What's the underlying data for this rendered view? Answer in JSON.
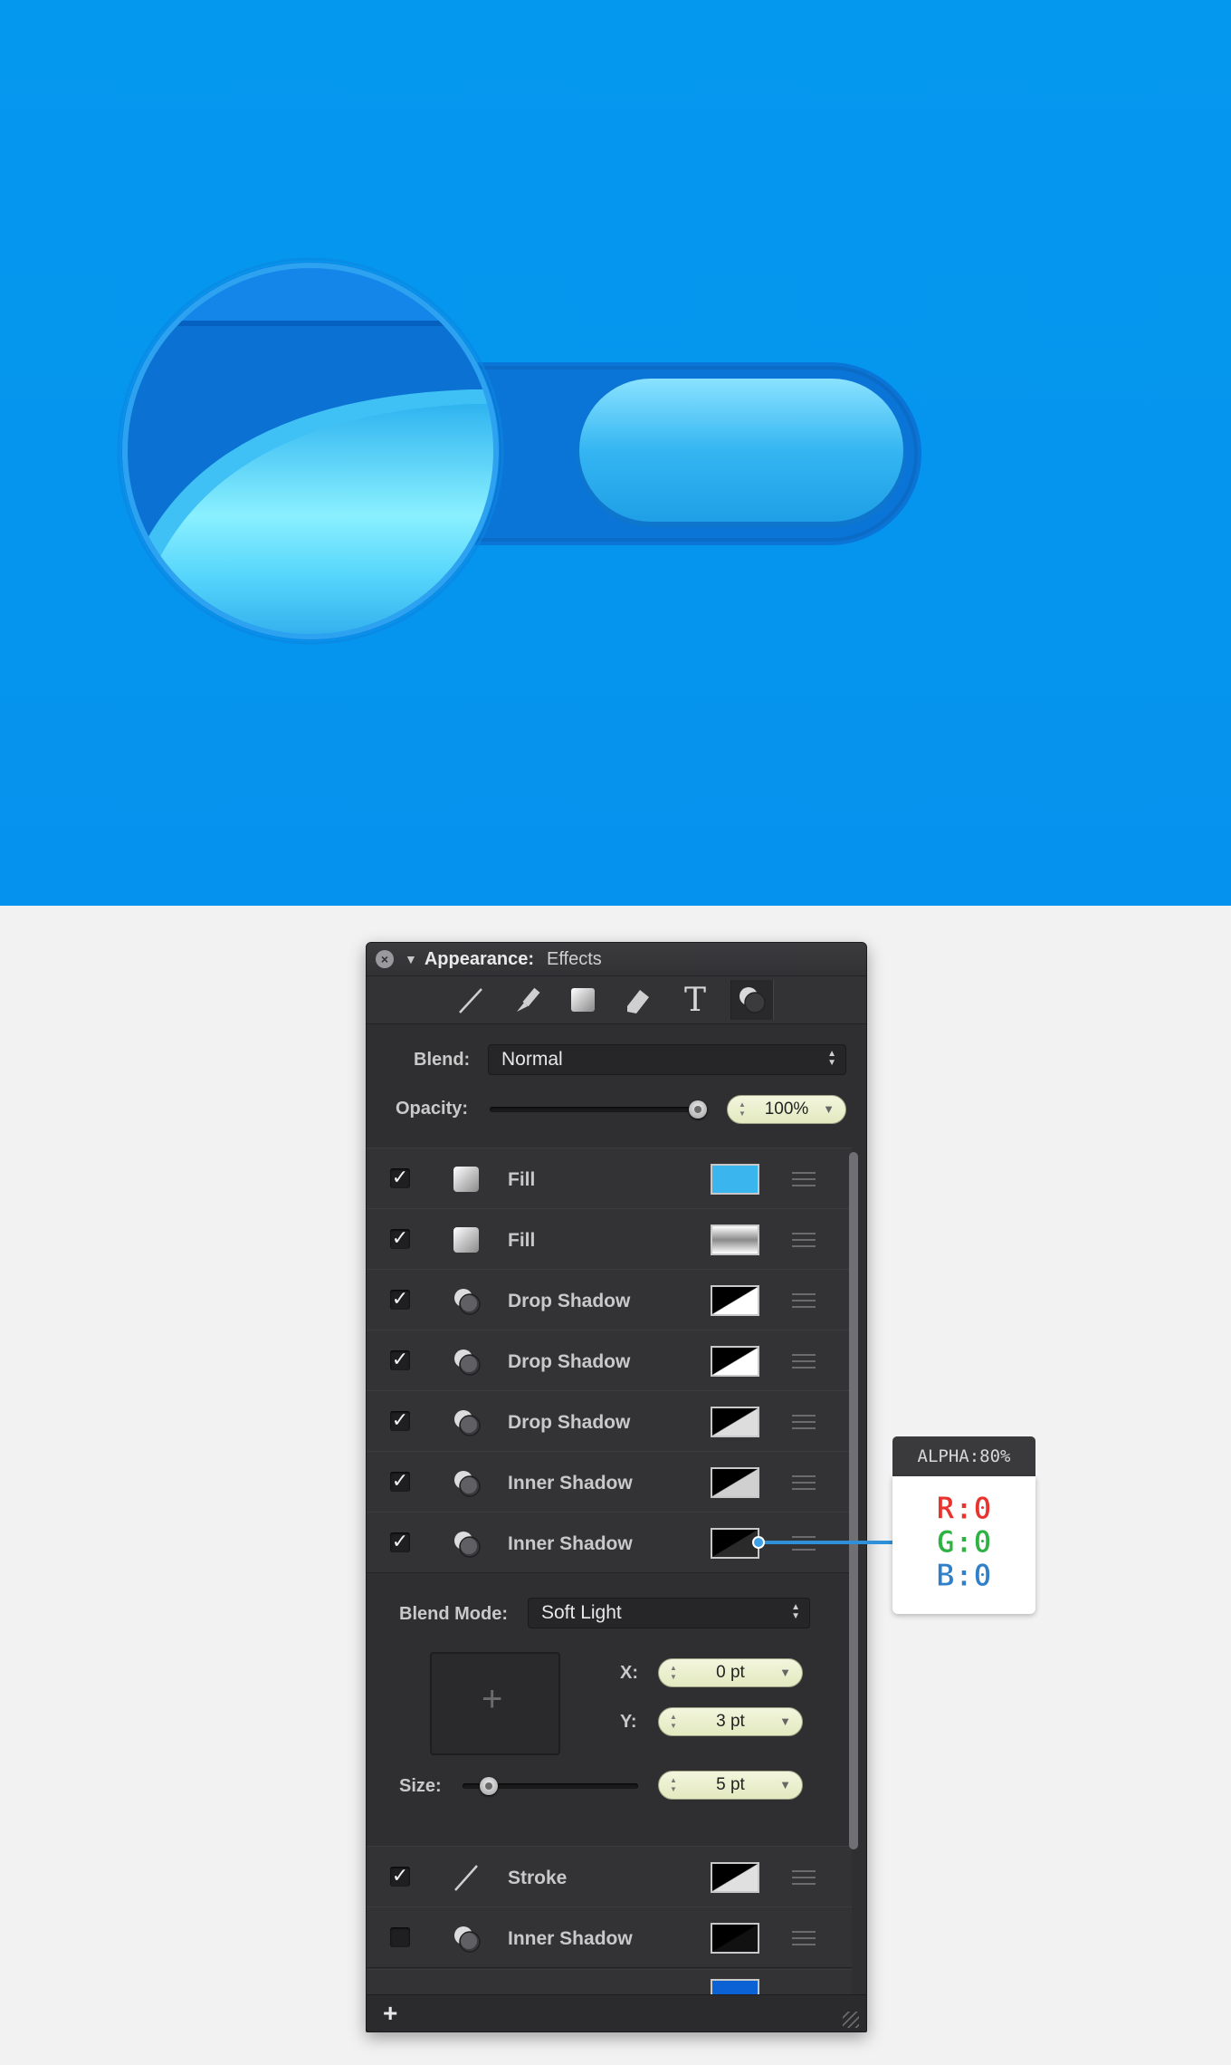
{
  "panel": {
    "title": "Appearance:",
    "subtitle": "Effects",
    "blend_label": "Blend:",
    "blend_value": "Normal",
    "opacity_label": "Opacity:",
    "opacity_value": "100%",
    "opacity_level": 1.0
  },
  "layers": [
    {
      "name": "Fill",
      "checked": true,
      "icon": "fill-icon"
    },
    {
      "name": "Fill",
      "checked": true,
      "icon": "fill-icon"
    },
    {
      "name": "Drop Shadow",
      "checked": true,
      "icon": "shadow-icon"
    },
    {
      "name": "Drop Shadow",
      "checked": true,
      "icon": "shadow-icon"
    },
    {
      "name": "Drop Shadow",
      "checked": true,
      "icon": "shadow-icon"
    },
    {
      "name": "Inner Shadow",
      "checked": true,
      "icon": "shadow-icon"
    },
    {
      "name": "Inner Shadow",
      "checked": true,
      "icon": "shadow-icon"
    }
  ],
  "detail": {
    "blend_mode_label": "Blend Mode:",
    "blend_mode_value": "Soft Light",
    "x_label": "X:",
    "x_value": "0 pt",
    "y_label": "Y:",
    "y_value": "3 pt",
    "size_label": "Size:",
    "size_value": "5 pt",
    "size_level": 0.1
  },
  "lower_layers": [
    {
      "name": "Stroke",
      "checked": true,
      "icon": "stroke-icon"
    },
    {
      "name": "Inner Shadow",
      "checked": false,
      "icon": "shadow-icon"
    }
  ],
  "tooltip": {
    "header": "ALPHA:80%",
    "r": "R:0",
    "g": "G:0",
    "b": "B:0"
  },
  "colors": {
    "canvas_blue": "#0596ef",
    "r": "#e8332f",
    "g": "#2fb244",
    "b": "#2f80c8"
  }
}
